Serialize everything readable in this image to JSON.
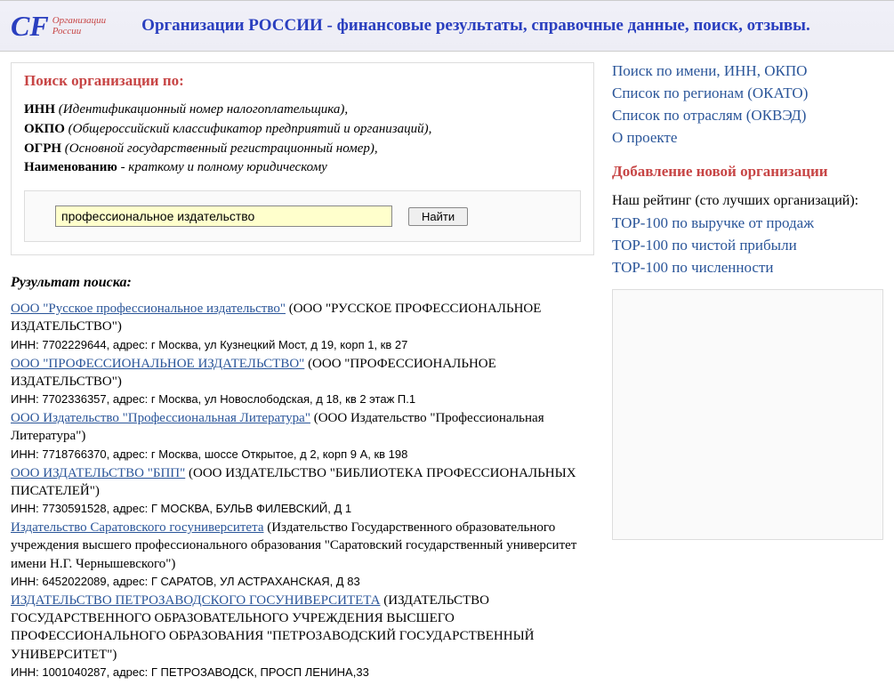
{
  "header": {
    "logo_small1": "Организации",
    "logo_small2": "России",
    "title": "Организации РОССИИ - финансовые результаты, справочные данные, поиск, отзывы."
  },
  "search": {
    "title": "Поиск организации по:",
    "criteria": [
      {
        "bold": "ИНН",
        "desc": " (Идентификационный номер налогоплательщика),"
      },
      {
        "bold": "ОКПО",
        "desc": " (Общероссийский классификатор предприятий и организаций),"
      },
      {
        "bold": "ОГРН",
        "desc": " (Основной государственный регистрационный номер),"
      },
      {
        "bold": "Наименованию",
        "desc": " - краткому и полному юридическому"
      }
    ],
    "input_value": "профессиональное издательство",
    "button": "Найти"
  },
  "results_title": "Рузультат поиска:",
  "results": [
    {
      "link": "ООО \"Русское профессиональное издательство\"",
      "paren": " (ООО \"РУССКОЕ ПРОФЕССИОНАЛЬНОЕ ИЗДАТЕЛЬСТВО\")",
      "meta": "ИНН: 7702229644, адрес: г Москва, ул Кузнецкий Мост, д 19, корп 1, кв 27"
    },
    {
      "link": "ООО \"ПРОФЕССИОНАЛЬНОЕ ИЗДАТЕЛЬСТВО\"",
      "paren": " (ООО \"ПРОФЕССИОНАЛЬНОЕ ИЗДАТЕЛЬСТВО\")",
      "meta": "ИНН: 7702336357, адрес: г Москва, ул Новослободская, д 18, кв 2 этаж П.1"
    },
    {
      "link": "ООО Издательство \"Профессиональная Литература\"",
      "paren": " (ООО Издательство \"Профессиональная Литература\")",
      "meta": "ИНН: 7718766370, адрес: г Москва, шоссе Открытое, д 2, корп 9 А, кв 198"
    },
    {
      "link": "ООО ИЗДАТЕЛЬСТВО \"БПП\"",
      "paren": " (ООО ИЗДАТЕЛЬСТВО \"БИБЛИОТЕКА ПРОФЕССИОНАЛЬНЫХ ПИСАТЕЛЕЙ\")",
      "meta": "ИНН: 7730591528, адрес: Г МОСКВА, БУЛЬВ ФИЛЕВСКИЙ, Д 1"
    },
    {
      "link": "Издательство Саратовского госуниверситета",
      "paren": " (Издательство Государственного образовательного учреждения высшего профессионального образования \"Саратовский государственный университет имени Н.Г. Чернышевского\")",
      "meta": "ИНН: 6452022089, адрес: Г САРАТОВ, УЛ АСТРАХАНСКАЯ, Д 83"
    },
    {
      "link": "ИЗДАТЕЛЬСТВО ПЕТРОЗАВОДСКОГО ГОСУНИВЕРСИТЕТА",
      "paren": " (ИЗДАТЕЛЬСТВО ГОСУДАРСТВЕННОГО ОБРАЗОВАТЕЛЬНОГО УЧРЕЖДЕНИЯ ВЫСШЕГО ПРОФЕССИОНАЛЬНОГО ОБРАЗОВАНИЯ \"ПЕТРОЗАВОДСКИЙ ГОСУДАРСТВЕННЫЙ УНИВЕРСИТЕТ\")",
      "meta": "ИНН: 1001040287, адрес: Г ПЕТРОЗАВОДСК, ПРОСП ЛЕНИНА,33"
    }
  ],
  "sidebar": {
    "links_top": [
      "Поиск по имени, ИНН, ОКПО",
      "Список по регионам (ОКАТО)",
      "Список по отраслям (ОКВЭД)",
      "О проекте"
    ],
    "add_new": "Добавление новой организации",
    "rating_label": "Наш рейтинг (сто лучших организаций):",
    "links_rating": [
      "TOP-100 по выручке от продаж",
      "TOP-100 по чистой прибыли",
      "TOP-100 по численности"
    ]
  }
}
